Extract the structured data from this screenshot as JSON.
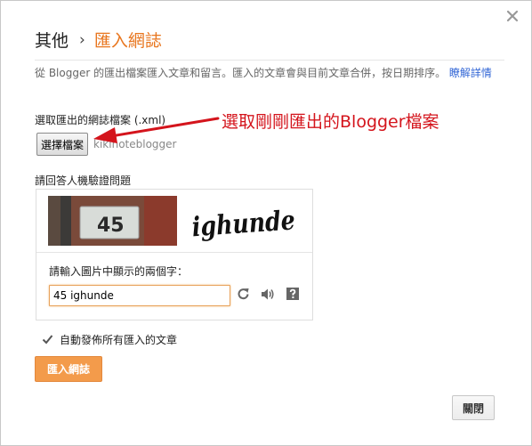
{
  "dialog": {
    "breadcrumb_parent": "其他",
    "breadcrumb_separator": "›",
    "title": "匯入網誌",
    "description_text": "從 Blogger 的匯出檔案匯入文章和留言。匯入的文章會與目前文章合併，按日期排序。",
    "description_link": "瞭解詳情"
  },
  "file_select": {
    "label": "選取匯出的網誌檔案 (.xml)",
    "button_label": "選擇檔案",
    "file_name": "kikinoteblogger"
  },
  "annotation": {
    "text": "選取剛剛匯出的Blogger檔案",
    "color": "#d4141c"
  },
  "captcha": {
    "title": "請回答人機驗證問題",
    "image_photo_text": "45",
    "image_word_text": "ighunde",
    "prompt": "請輸入圖片中顯示的兩個字：",
    "input_value": "45 ighunde",
    "icons": [
      "refresh-icon",
      "audio-icon",
      "help-icon"
    ]
  },
  "auto_publish": {
    "label": "自動發佈所有匯入的文章",
    "checked": true
  },
  "buttons": {
    "import_label": "匯入網誌",
    "close_label": "關閉"
  },
  "colors": {
    "accent_orange": "#f39b4b",
    "title_orange": "#e8761f",
    "link_blue": "#3367d6"
  }
}
